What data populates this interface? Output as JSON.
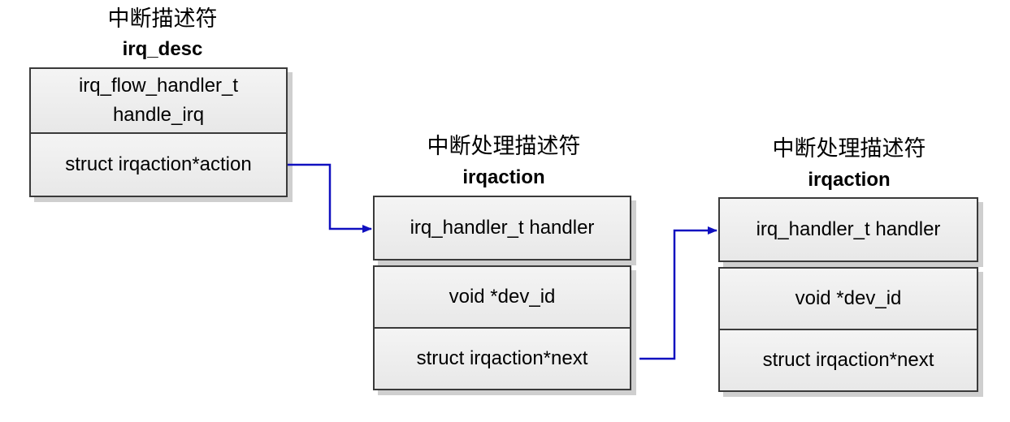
{
  "irq_desc": {
    "title_cn": "中断描述符",
    "title_en": "irq_desc",
    "fields": [
      {
        "line1": "irq_flow_handler_t",
        "line2": "handle_irq"
      },
      {
        "line1": "struct irqaction*action",
        "line2": ""
      }
    ]
  },
  "irqaction_1": {
    "title_cn": "中断处理描述符",
    "title_en": "irqaction",
    "fields": [
      {
        "line1": "irq_handler_t handler"
      },
      {
        "line1": "void *dev_id"
      },
      {
        "line1": "struct irqaction*next"
      }
    ]
  },
  "irqaction_2": {
    "title_cn": "中断处理描述符",
    "title_en": "irqaction",
    "fields": [
      {
        "line1": "irq_handler_t handler"
      },
      {
        "line1": "void *dev_id"
      },
      {
        "line1": "struct irqaction*next"
      }
    ]
  },
  "colors": {
    "arrow": "#1010c0",
    "border": "#3a3a3a",
    "field_fill": "#eeeeee"
  }
}
